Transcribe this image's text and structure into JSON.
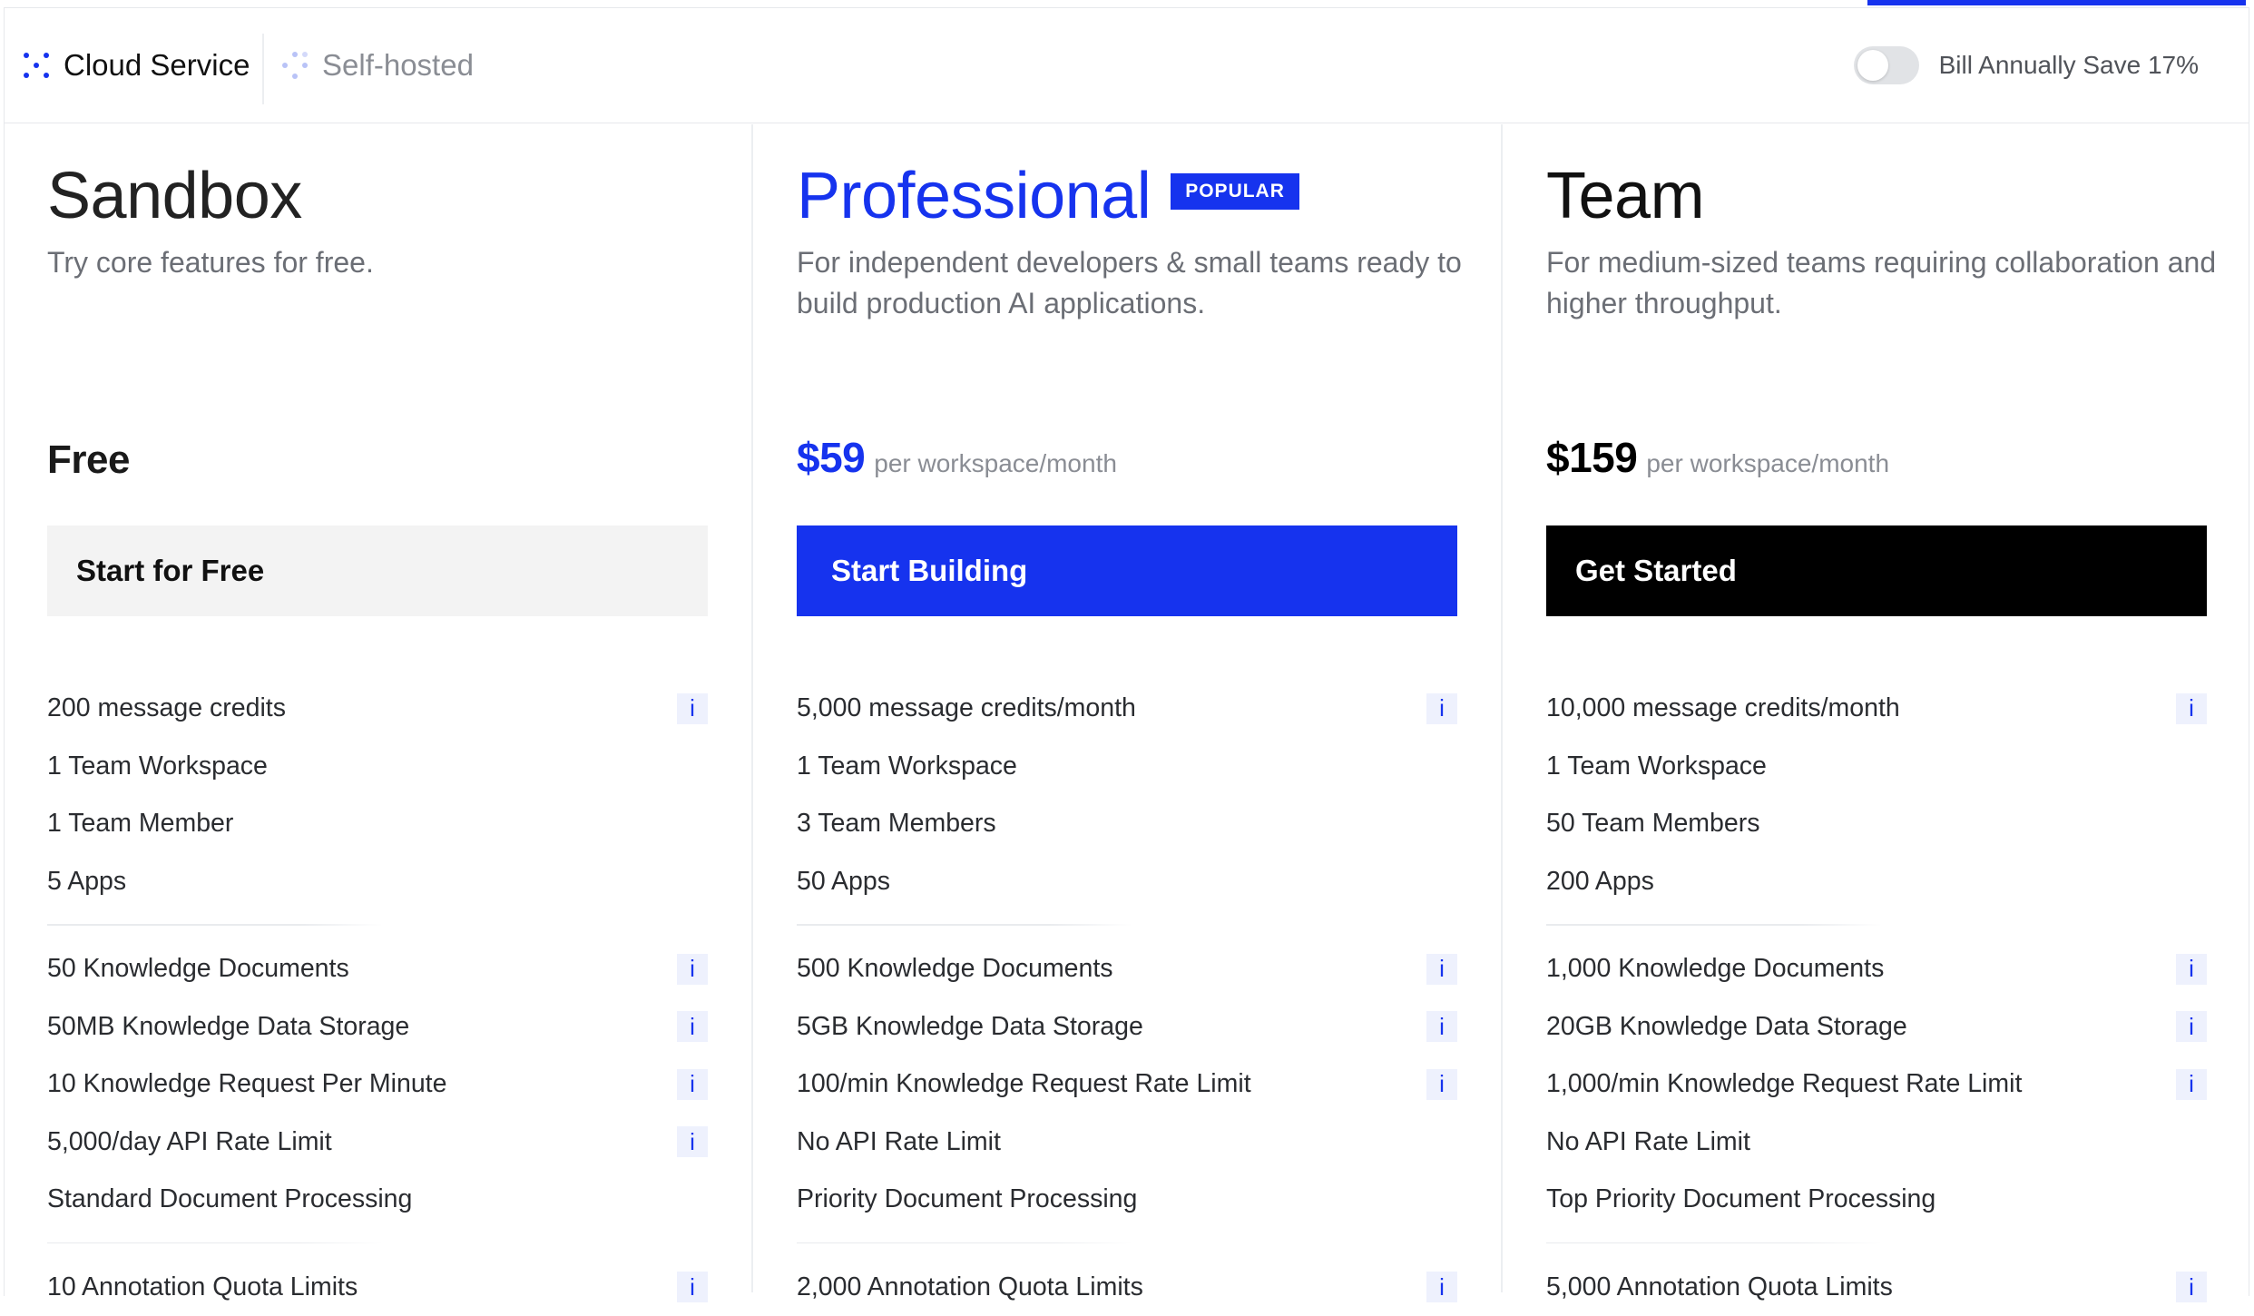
{
  "header": {
    "tabs": [
      {
        "label": "Cloud Service",
        "icon": "cloud-dots-icon"
      },
      {
        "label": "Self-hosted",
        "icon": "server-dots-icon"
      }
    ],
    "billing_toggle": {
      "label": "Bill Annually Save 17%",
      "on": false
    }
  },
  "colors": {
    "accent": "#1633ee",
    "dark": "#000000",
    "light_button": "#f3f3f3"
  },
  "plans": [
    {
      "name": "Sandbox",
      "description": "Try core features for free.",
      "price": "Free",
      "price_unit": "",
      "cta": "Start for Free",
      "groups": [
        [
          "200 message credits",
          "1 Team Workspace",
          "1 Team Member",
          "5 Apps"
        ],
        [
          "50 Knowledge Documents",
          "50MB Knowledge Data Storage",
          "10 Knowledge Request Per Minute",
          "5,000/day API Rate Limit",
          "Standard Document Processing"
        ],
        [
          "10 Annotation Quota Limits"
        ]
      ]
    },
    {
      "name": "Professional",
      "badge": "POPULAR",
      "description": "For independent developers & small teams ready to build production AI applications.",
      "price": "$59",
      "price_unit": "per workspace/month",
      "cta": "Start Building",
      "groups": [
        [
          "5,000 message credits/month",
          "1 Team Workspace",
          "3 Team Members",
          "50 Apps"
        ],
        [
          "500 Knowledge Documents",
          "5GB Knowledge Data Storage",
          "100/min Knowledge Request Rate Limit",
          "No API Rate Limit",
          "Priority Document Processing"
        ],
        [
          "2,000 Annotation Quota Limits"
        ]
      ]
    },
    {
      "name": "Team",
      "description": "For medium-sized teams requiring collaboration and higher throughput.",
      "price": "$159",
      "price_unit": "per workspace/month",
      "cta": "Get Started",
      "groups": [
        [
          "10,000 message credits/month",
          "1 Team Workspace",
          "50 Team Members",
          "200 Apps"
        ],
        [
          "1,000 Knowledge Documents",
          "20GB Knowledge Data Storage",
          "1,000/min Knowledge Request Rate Limit",
          "No API Rate Limit",
          "Top Priority Document Processing"
        ],
        [
          "5,000 Annotation Quota Limits"
        ]
      ]
    }
  ],
  "info_icon_glyph": "i"
}
